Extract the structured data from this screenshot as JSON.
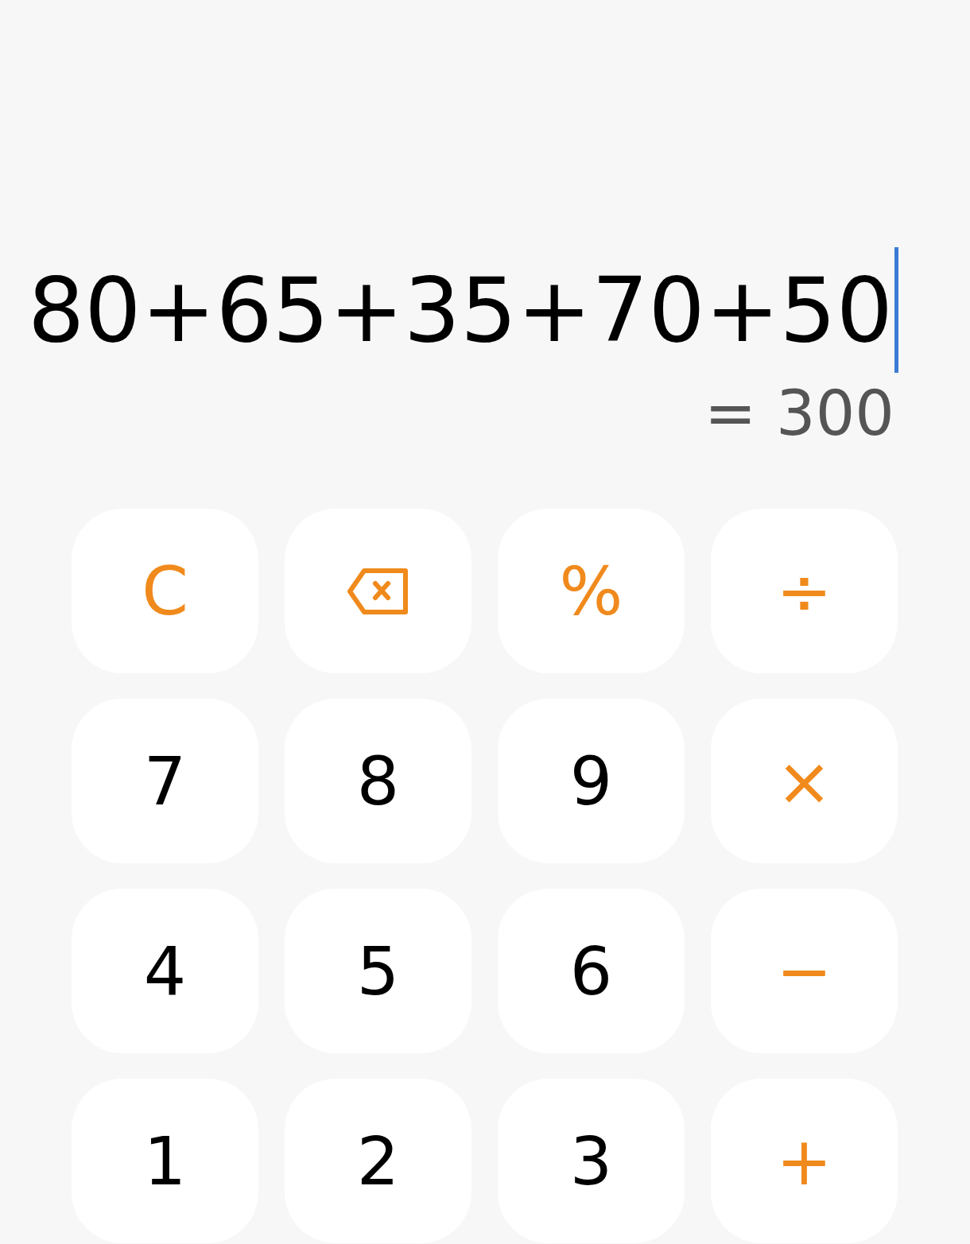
{
  "display": {
    "expression": "80+65+35+70+50",
    "cursor": true,
    "result": "= 300"
  },
  "keys": [
    {
      "kind": "operator",
      "label": "C"
    },
    {
      "kind": "backspace"
    },
    {
      "kind": "operator",
      "label": "%"
    },
    {
      "kind": "operator",
      "label": "÷"
    },
    {
      "kind": "digit",
      "label": "7"
    },
    {
      "kind": "digit",
      "label": "8"
    },
    {
      "kind": "digit",
      "label": "9"
    },
    {
      "kind": "operator",
      "label": "×"
    },
    {
      "kind": "digit",
      "label": "4"
    },
    {
      "kind": "digit",
      "label": "5"
    },
    {
      "kind": "digit",
      "label": "6"
    },
    {
      "kind": "operator",
      "label": "−"
    },
    {
      "kind": "digit",
      "label": "1"
    },
    {
      "kind": "digit",
      "label": "2"
    },
    {
      "kind": "digit",
      "label": "3"
    },
    {
      "kind": "operator",
      "label": "+"
    }
  ]
}
